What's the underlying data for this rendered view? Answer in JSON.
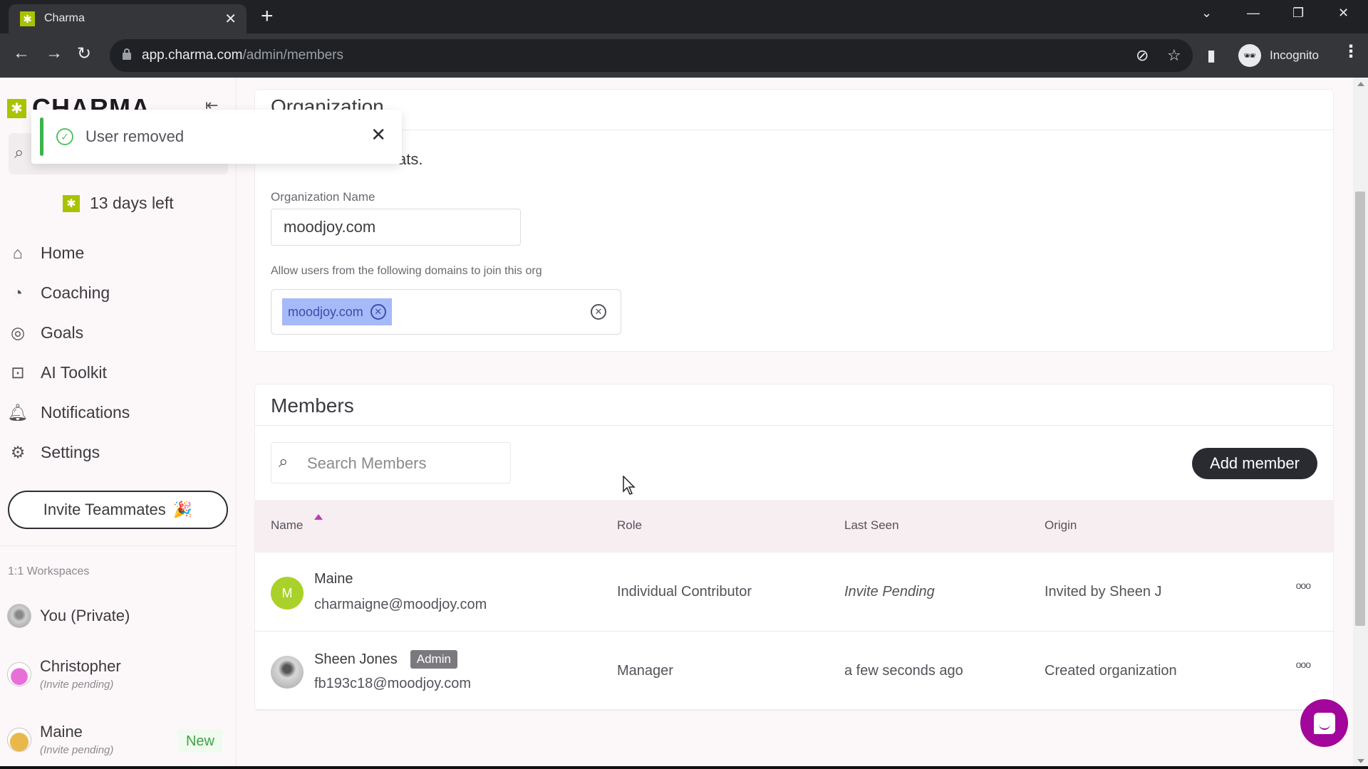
{
  "browser": {
    "tab_title": "Charma",
    "url_host": "app.charma.com",
    "url_path": "/admin/members",
    "profile_label": "Incognito"
  },
  "sidebar": {
    "logo_text": "CHARMA",
    "trial_text": "13 days left",
    "nav": [
      {
        "label": "Home",
        "icon": "home-heart-icon"
      },
      {
        "label": "Coaching",
        "icon": "whistle-icon"
      },
      {
        "label": "Goals",
        "icon": "target-icon"
      },
      {
        "label": "AI Toolkit",
        "icon": "robot-icon"
      },
      {
        "label": "Notifications",
        "icon": "bell-icon"
      },
      {
        "label": "Settings",
        "icon": "gear-icon"
      }
    ],
    "invite_label": "Invite Teammates",
    "invite_emoji": "🎉",
    "workspaces_label": "1:1 Workspaces",
    "workspaces": [
      {
        "name": "You (Private)",
        "sub": ""
      },
      {
        "name": "Christopher",
        "sub": "(Invite pending)"
      },
      {
        "name": "Maine",
        "sub": "(Invite pending)",
        "badge": "New"
      }
    ]
  },
  "toast": {
    "message": "User removed"
  },
  "organization": {
    "title": "Organization",
    "description_fragment": "ats.",
    "name_label": "Organization Name",
    "name_value": "moodjoy.com",
    "domains_label": "Allow users from the following domains to join this org",
    "domains": [
      "moodjoy.com"
    ]
  },
  "members": {
    "title": "Members",
    "search_placeholder": "Search Members",
    "add_button": "Add member",
    "columns": [
      "Name",
      "Role",
      "Last Seen",
      "Origin"
    ],
    "rows": [
      {
        "initial": "M",
        "name": "Maine",
        "email": "charmaigne@moodjoy.com",
        "badge": "",
        "role": "Individual Contributor",
        "last_seen": "Invite Pending",
        "origin": "Invited by Sheen J"
      },
      {
        "initial": "",
        "name": "Sheen Jones",
        "email": "fb193c18@moodjoy.com",
        "badge": "Admin",
        "role": "Manager",
        "last_seen": "a few seconds ago",
        "origin": "Created organization"
      }
    ]
  },
  "colors": {
    "brand_green": "#a9c300",
    "accent_magenta": "#a2069b",
    "success": "#3cb44b",
    "tag_bg": "#a6b9f9"
  }
}
